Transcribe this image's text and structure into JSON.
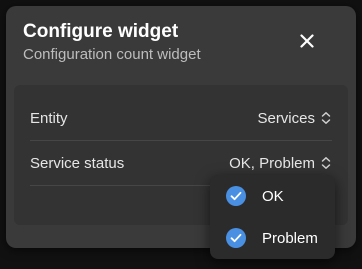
{
  "dialog": {
    "title": "Configure widget",
    "subtitle": "Configuration count widget",
    "close_icon": "close-icon"
  },
  "fields": [
    {
      "label": "Entity",
      "value": "Services"
    },
    {
      "label": "Service status",
      "value": "OK, Problem"
    }
  ],
  "dropdown": {
    "options": [
      {
        "label": "OK",
        "checked": true
      },
      {
        "label": "Problem",
        "checked": true
      }
    ]
  },
  "colors": {
    "accent": "#4a90e2",
    "dialog_bg": "#3a3a3a",
    "text": "#e6e6e6"
  }
}
